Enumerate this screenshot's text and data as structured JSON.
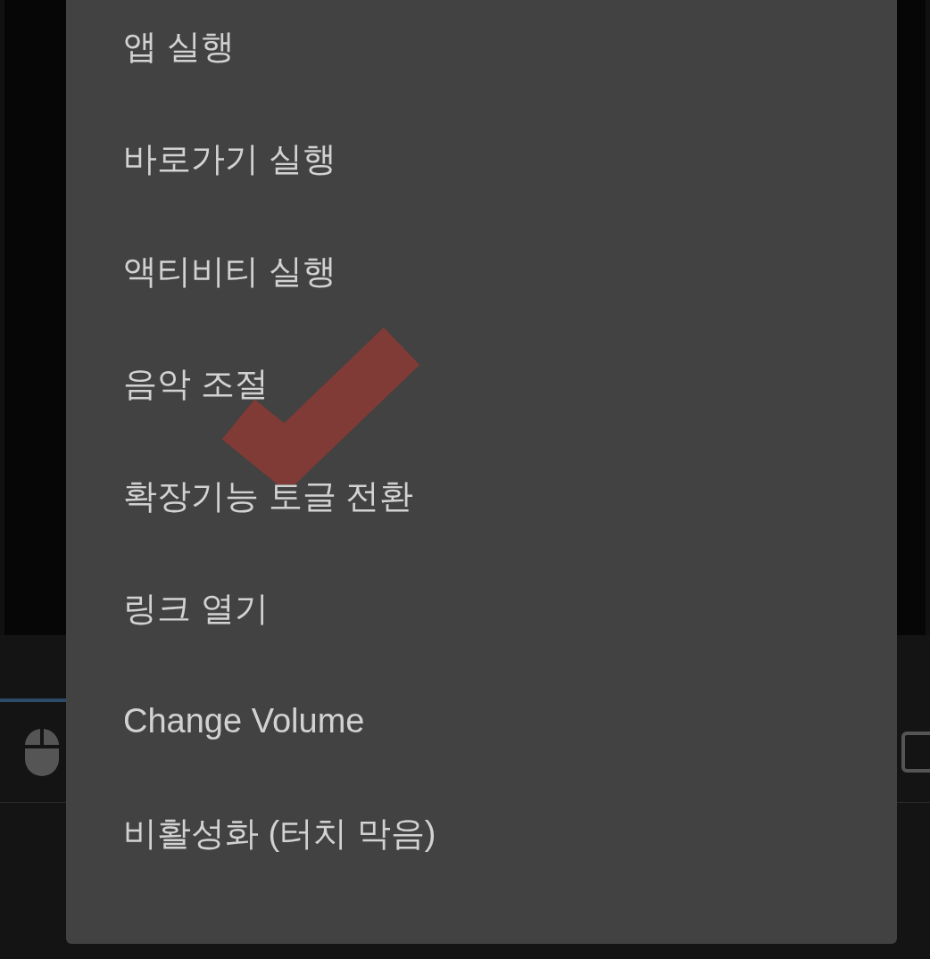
{
  "menu": {
    "items": [
      {
        "label": "앱 실행"
      },
      {
        "label": "바로가기 실행"
      },
      {
        "label": "액티비티 실행"
      },
      {
        "label": "음악 조절"
      },
      {
        "label": "확장기능 토글 전환"
      },
      {
        "label": "링크 열기"
      },
      {
        "label": "Change Volume"
      },
      {
        "label": "비활성화 (터치 막음)"
      }
    ]
  },
  "row": {
    "checkbox": {
      "checked": false
    }
  }
}
